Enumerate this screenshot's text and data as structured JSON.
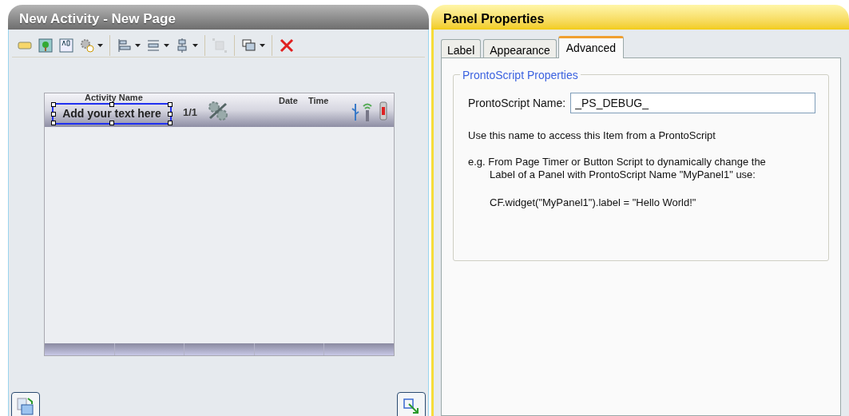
{
  "editor": {
    "title": "New Activity - New Page",
    "toolbar_groups": [
      [
        {
          "kind": "panel",
          "disabled": false
        },
        {
          "kind": "image",
          "disabled": false
        },
        {
          "kind": "text",
          "disabled": false
        },
        {
          "kind": "gear",
          "disabled": false
        }
      ],
      [
        {
          "kind": "align",
          "disabled": false
        },
        {
          "kind": "vspace",
          "disabled": false
        },
        {
          "kind": "center",
          "disabled": false
        }
      ],
      [
        {
          "kind": "group",
          "disabled": true
        }
      ],
      [
        {
          "kind": "layers",
          "disabled": false
        }
      ],
      [
        {
          "kind": "delete",
          "disabled": false
        }
      ]
    ],
    "device": {
      "text_label": "Add your text here",
      "activity_name": "Activity Name",
      "page_count": "1/1",
      "date": "Date",
      "time": "Time",
      "label_selected": true
    }
  },
  "properties": {
    "title": "Panel Properties",
    "tabs": [
      {
        "label": "Label",
        "selected": false
      },
      {
        "label": "Appearance",
        "selected": false
      },
      {
        "label": "Advanced",
        "selected": true
      }
    ],
    "group_title": "ProntoScript Properties",
    "name_label": "ProntoScript Name:",
    "name_value": "_PS_DEBUG_",
    "hint": "Use this name to access this Item from a ProntoScript",
    "example": "e.g. From Page Timer or Button Script to dynamically change the\nLabel of a Panel with ProntoScript Name \"MyPanel1\" use:",
    "code": "CF.widget(\"MyPanel1\").label = \"Hello World!\""
  }
}
